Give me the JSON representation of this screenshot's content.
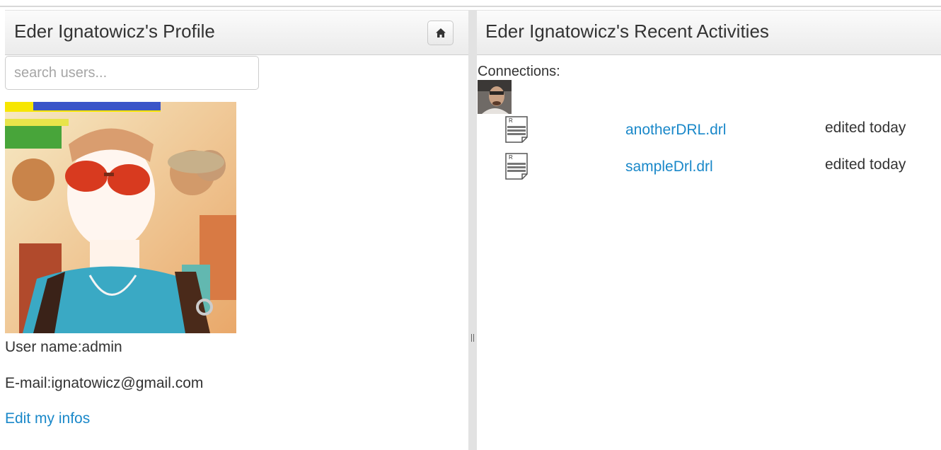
{
  "profile_panel": {
    "title": "Eder Ignatowicz's Profile",
    "home_icon": "home-icon",
    "search": {
      "placeholder": "search users..."
    },
    "user_name": "User name:admin",
    "email": "E-mail:ignatowicz@gmail.com",
    "edit_link": "Edit my infos"
  },
  "activity_panel": {
    "title": "Eder Ignatowicz's Recent Activities",
    "connections_label": "Connections:",
    "activities": [
      {
        "icon": "rule-file-icon",
        "file": "anotherDRL.drl",
        "status": "edited today"
      },
      {
        "icon": "rule-file-icon",
        "file": "sampleDrl.drl",
        "status": "edited today"
      }
    ]
  },
  "colors": {
    "link": "#1a88c9",
    "header_top": "#fbfbfb",
    "header_bottom": "#ebebeb",
    "splitter": "#e2e2e2"
  }
}
